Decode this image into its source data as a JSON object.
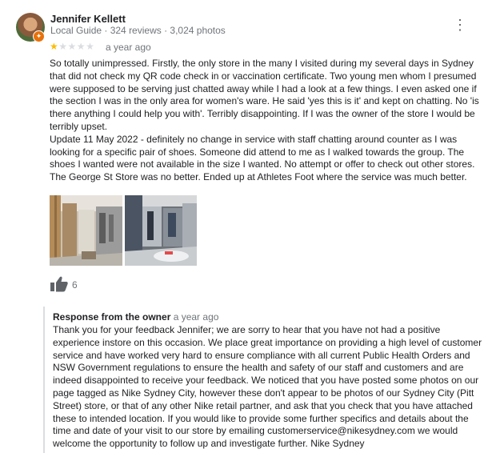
{
  "reviewer": {
    "name": "Jennifer Kellett",
    "meta": "Local Guide · 324 reviews · 3,024 photos"
  },
  "review": {
    "rating": 1,
    "rating_max": 5,
    "time": "a year ago",
    "paragraphs": [
      "So totally unimpressed. Firstly, the only store in the many I visited during my several days in Sydney that did not check my QR code check in or vaccination certificate. Two young men whom I presumed were supposed to be serving just chatted away while I had a look at a few things. I even asked one if the section I was in the only area for women's ware. He said 'yes this is it' and  kept on chatting. No 'is there anything I could help you with'. Terribly disappointing. If I was the owner of the store I would be terribly upset.",
      "Update 11 May 2022 - definitely no change in service with staff chatting around counter as I was looking for a specific pair of shoes. Someone did attend to me as I walked towards the group. The shoes I wanted were not available in the size I wanted. No attempt or offer to check out other stores. The George St Store was no better. Ended up at Athletes Foot where the service was much better."
    ],
    "likes": "6"
  },
  "owner_response": {
    "label": "Response from the owner",
    "time": "a year ago",
    "text": "Thank you for your feedback Jennifer; we are sorry to hear that you have not had a positive experience instore on this occasion. We place great importance on providing a high level of customer service and have worked very hard to ensure compliance with all current Public Health Orders and NSW Government regulations to ensure the health and safety of our staff and customers and are indeed disappointed to receive your feedback. We noticed that you have posted some photos on our page tagged as Nike Sydney City, however these don't appear to be photos of our Sydney City (Pitt Street) store, or that of any other Nike retail partner, and ask that you check that you have attached these to intended location. If you would like to provide some further specifics and details about the time and date of your visit to our store by emailing customerservice@nikesydney.com we would welcome the opportunity to follow up and investigate further. Nike Sydney"
  },
  "icons": {
    "more": "more-vert-icon",
    "like": "thumb-up-icon",
    "star": "star-icon",
    "badge": "local-guide-badge-icon"
  },
  "colors": {
    "star_filled": "#fbbc04",
    "star_empty": "#dadce0",
    "meta_text": "#70757a",
    "badge": "#e8710a"
  }
}
